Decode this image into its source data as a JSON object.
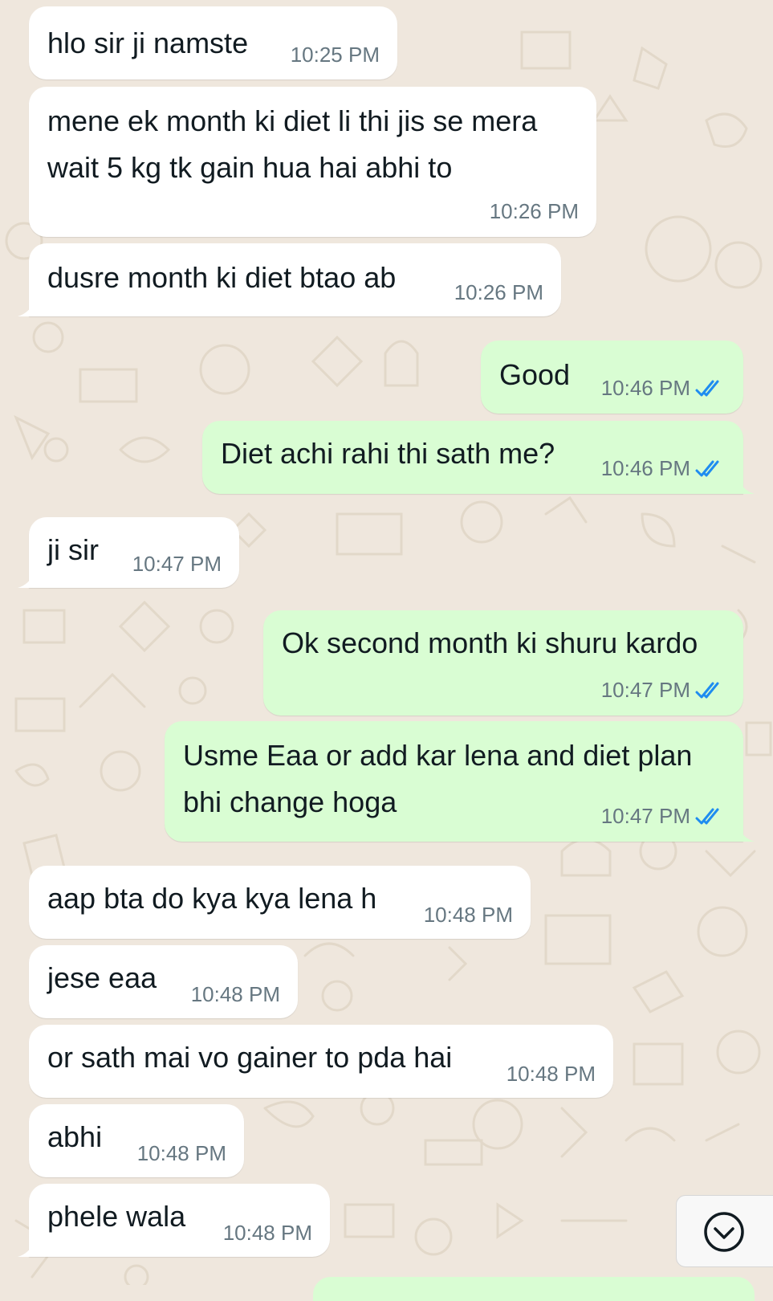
{
  "messages": [
    {
      "direction": "incoming",
      "text": "hlo sir ji namste",
      "time": "10:25 PM"
    },
    {
      "direction": "incoming",
      "text_lines": [
        "mene ek month ki diet li thi jis se mera",
        "wait 5 kg tk gain hua hai abhi to"
      ],
      "time": "10:26 PM"
    },
    {
      "direction": "incoming",
      "text": "dusre month ki diet btao ab",
      "time": "10:26 PM"
    },
    {
      "direction": "outgoing",
      "text": "Good",
      "time": "10:46 PM",
      "status": "read"
    },
    {
      "direction": "outgoing",
      "text": "Diet achi rahi thi sath me?",
      "time": "10:46 PM",
      "status": "read"
    },
    {
      "direction": "incoming",
      "text": "ji sir",
      "time": "10:47 PM"
    },
    {
      "direction": "outgoing",
      "text": "Ok second month ki shuru kardo",
      "time": "10:47 PM",
      "status": "read"
    },
    {
      "direction": "outgoing",
      "text_lines": [
        "Usme Eaa or add kar lena and diet plan",
        "bhi change hoga"
      ],
      "time": "10:47 PM",
      "status": "read"
    },
    {
      "direction": "incoming",
      "text": "aap bta do kya kya lena h",
      "time": "10:48 PM"
    },
    {
      "direction": "incoming",
      "text": "jese eaa",
      "time": "10:48 PM"
    },
    {
      "direction": "incoming",
      "text": "or sath mai vo gainer to pda hai",
      "time": "10:48 PM"
    },
    {
      "direction": "incoming",
      "text": "abhi",
      "time": "10:48 PM"
    },
    {
      "direction": "incoming",
      "text": "phele wala",
      "time": "10:48 PM"
    }
  ],
  "icons": {
    "read_receipt": "double-check-icon",
    "scroll_down": "chevron-down-icon"
  },
  "colors": {
    "incoming_bubble": "#ffffff",
    "outgoing_bubble": "#d9fdd3",
    "wallpaper": "#efe7dd",
    "read_tick": "#1f8cf0",
    "meta_text": "#667781"
  }
}
